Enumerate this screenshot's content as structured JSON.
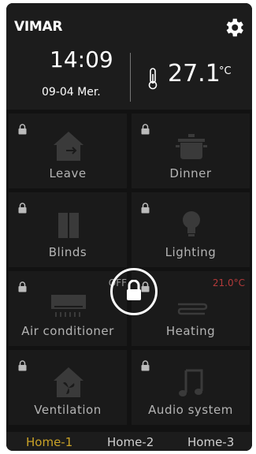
{
  "header": {
    "brand": "VIMAR",
    "time": "14:09",
    "date": "09-04 Mer.",
    "temperature": "27.1",
    "temperature_unit": "°C"
  },
  "tiles": [
    {
      "label": "Leave",
      "icon": "house-leave-icon"
    },
    {
      "label": "Dinner",
      "icon": "cooking-pot-icon"
    },
    {
      "label": "Blinds",
      "icon": "blinds-icon"
    },
    {
      "label": "Lighting",
      "icon": "light-bulb-icon"
    },
    {
      "label": "Air conditioner",
      "icon": "air-conditioner-icon",
      "status": "OFF"
    },
    {
      "label": "Heating",
      "icon": "heating-icon",
      "status": "21.0°C"
    },
    {
      "label": "Ventilation",
      "icon": "fan-house-icon"
    },
    {
      "label": "Audio system",
      "icon": "music-note-icon"
    }
  ],
  "tabs": [
    {
      "label": "Home-1",
      "active": true
    },
    {
      "label": "Home-2",
      "active": false
    },
    {
      "label": "Home-3",
      "active": false
    }
  ],
  "colors": {
    "active_tab": "#c9a227",
    "inactive_tab": "#d0d0d0",
    "heating_status": "#b43a3a",
    "off_status": "#9a9a9a"
  }
}
